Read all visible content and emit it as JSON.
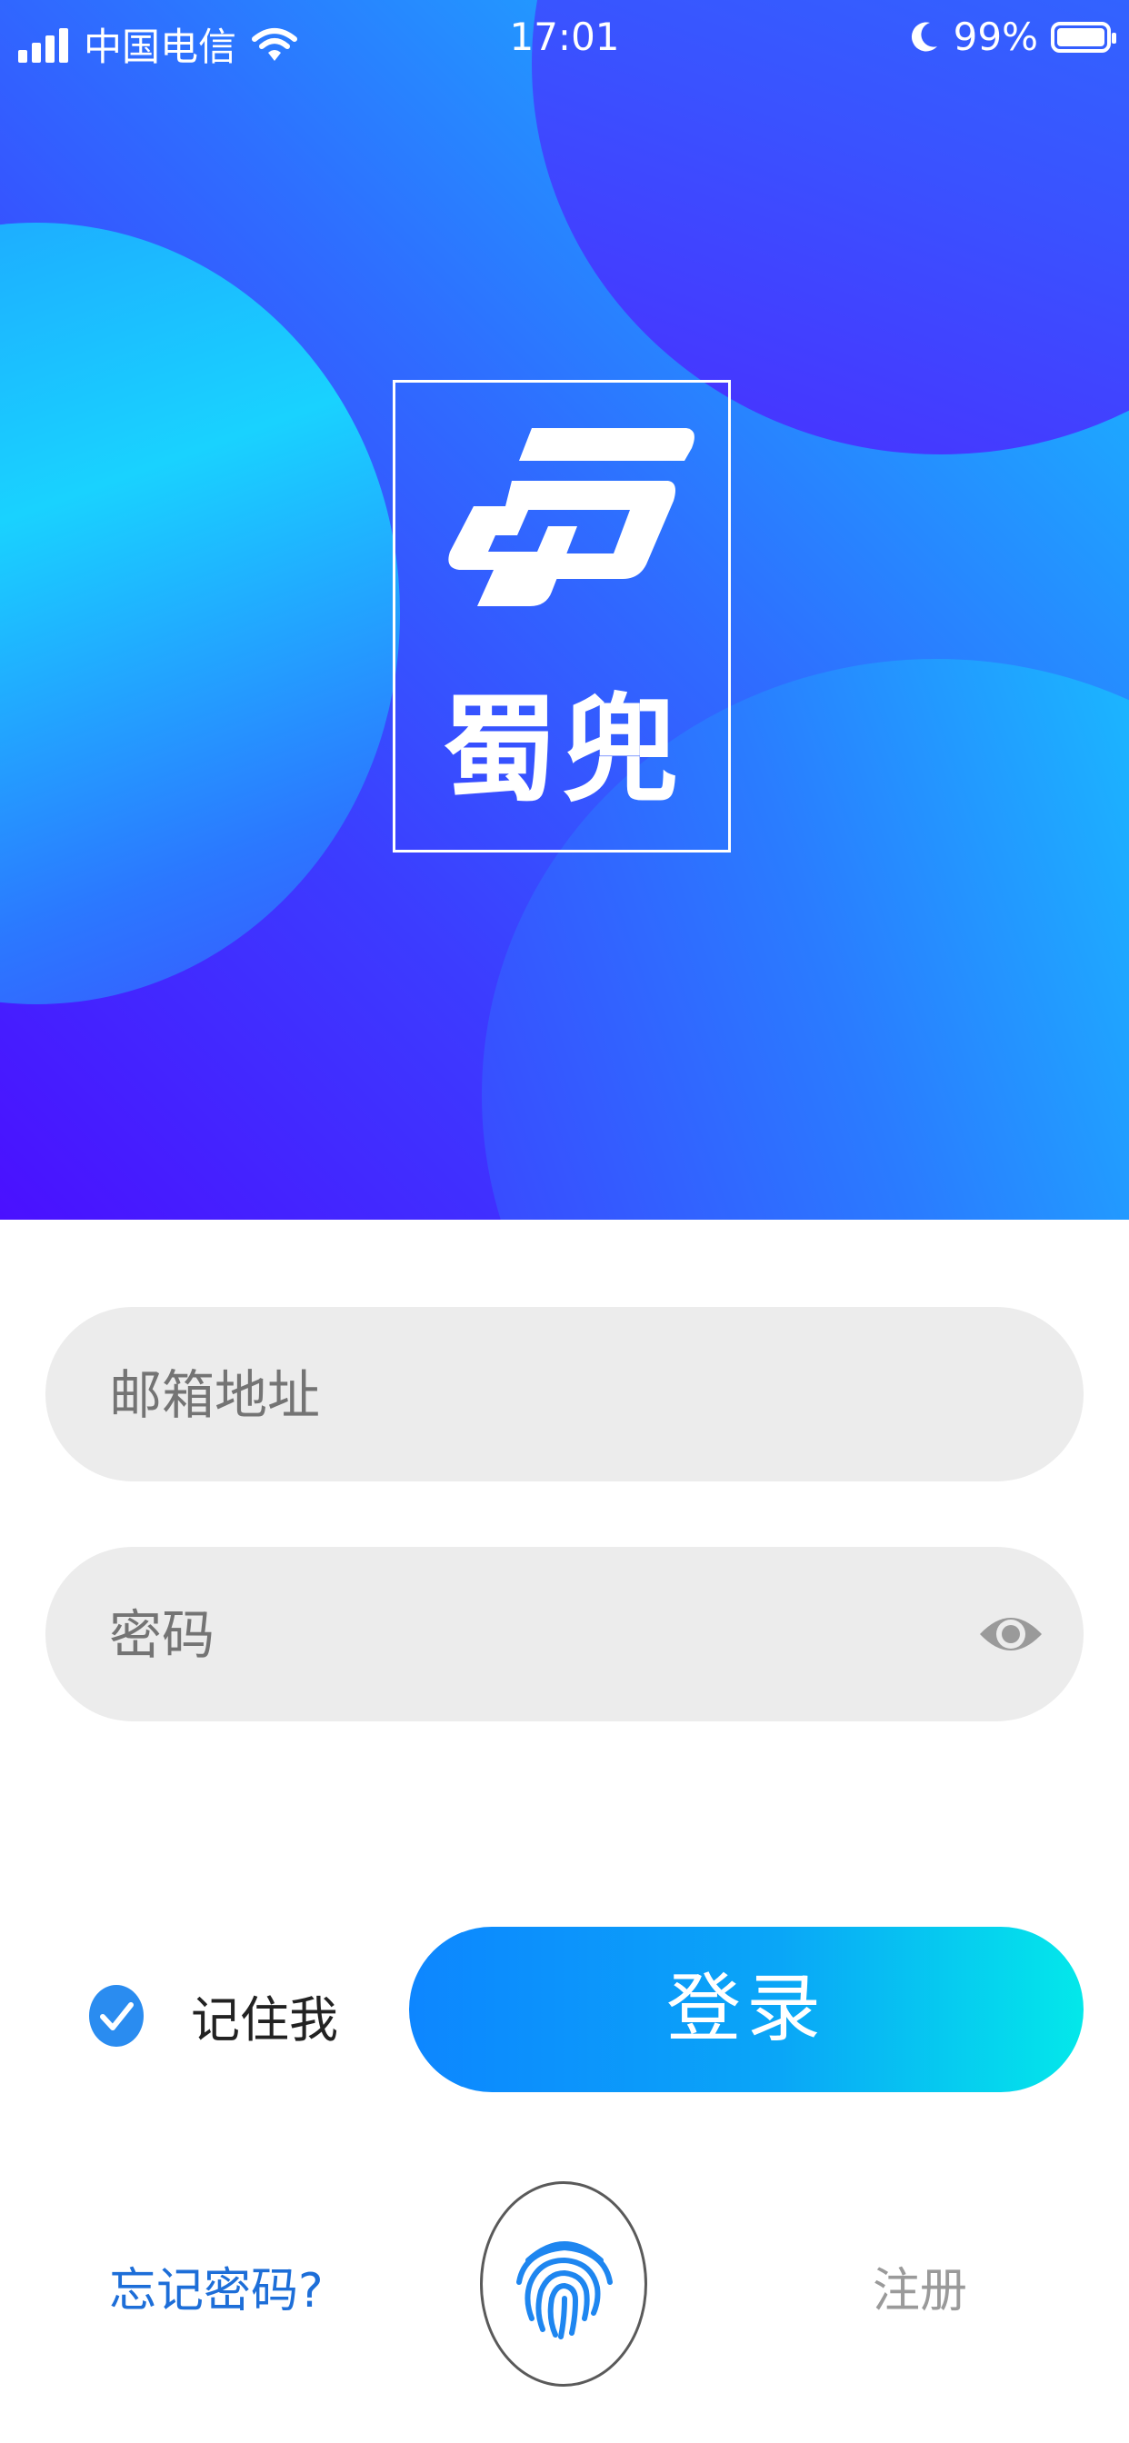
{
  "status_bar": {
    "carrier": "中国电信",
    "time": "17:01",
    "battery": "99%"
  },
  "brand": {
    "name": "蜀兜"
  },
  "form": {
    "email_placeholder": "邮箱地址",
    "password_placeholder": "密码",
    "remember_label": "记住我",
    "remember_checked": true,
    "login_label": "登录"
  },
  "links": {
    "forgot": "忘记密码?",
    "register": "注册"
  },
  "icons": {
    "signal": "signal-icon",
    "wifi": "wifi-icon",
    "moon": "moon-icon",
    "battery": "battery-icon",
    "logo": "logo-mark-icon",
    "eye": "eye-icon",
    "check": "check-icon",
    "fingerprint": "fingerprint-icon"
  },
  "colors": {
    "accent_blue": "#1d6ed8",
    "check_blue": "#2a8cf0",
    "login_start": "#0d86ff",
    "login_end": "#03e8ea",
    "input_bg": "#ececec"
  }
}
